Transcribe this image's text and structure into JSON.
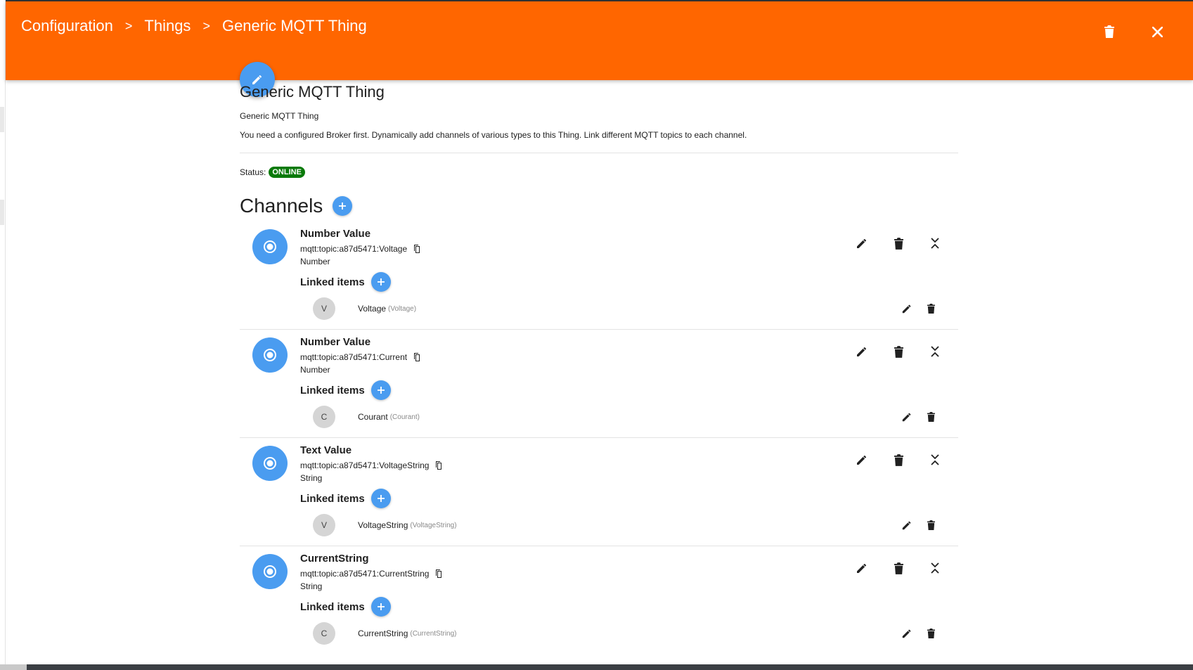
{
  "breadcrumb": {
    "items": [
      "Configuration",
      "Things",
      "Generic MQTT Thing"
    ],
    "separator": ">"
  },
  "header": {
    "delete_icon": "trash-icon",
    "close_icon": "close-icon",
    "background_color": "#ff6600"
  },
  "thing": {
    "title": "Generic MQTT Thing",
    "subtitle": "Generic MQTT Thing",
    "description": "You need a configured Broker first. Dynamically add channels of various types to this Thing. Link different MQTT topics to each channel.",
    "status_label": "Status:",
    "status_value": "ONLINE",
    "status_color": "#0a7a0a"
  },
  "channels": {
    "title": "Channels",
    "accent_color": "#4a9cf0",
    "linked_items_label": "Linked items",
    "list": [
      {
        "label": "Number Value",
        "uid": "mqtt:topic:a87d5471:Voltage",
        "type": "Number",
        "item": {
          "initial": "V",
          "label": "Voltage",
          "name": "(Voltage)"
        }
      },
      {
        "label": "Number Value",
        "uid": "mqtt:topic:a87d5471:Current",
        "type": "Number",
        "item": {
          "initial": "C",
          "label": "Courant",
          "name": "(Courant)"
        }
      },
      {
        "label": "Text Value",
        "uid": "mqtt:topic:a87d5471:VoltageString",
        "type": "String",
        "item": {
          "initial": "V",
          "label": "VoltageString",
          "name": "(VoltageString)"
        }
      },
      {
        "label": "CurrentString",
        "uid": "mqtt:topic:a87d5471:CurrentString",
        "type": "String",
        "item": {
          "initial": "C",
          "label": "CurrentString",
          "name": "(CurrentString)"
        }
      }
    ]
  }
}
